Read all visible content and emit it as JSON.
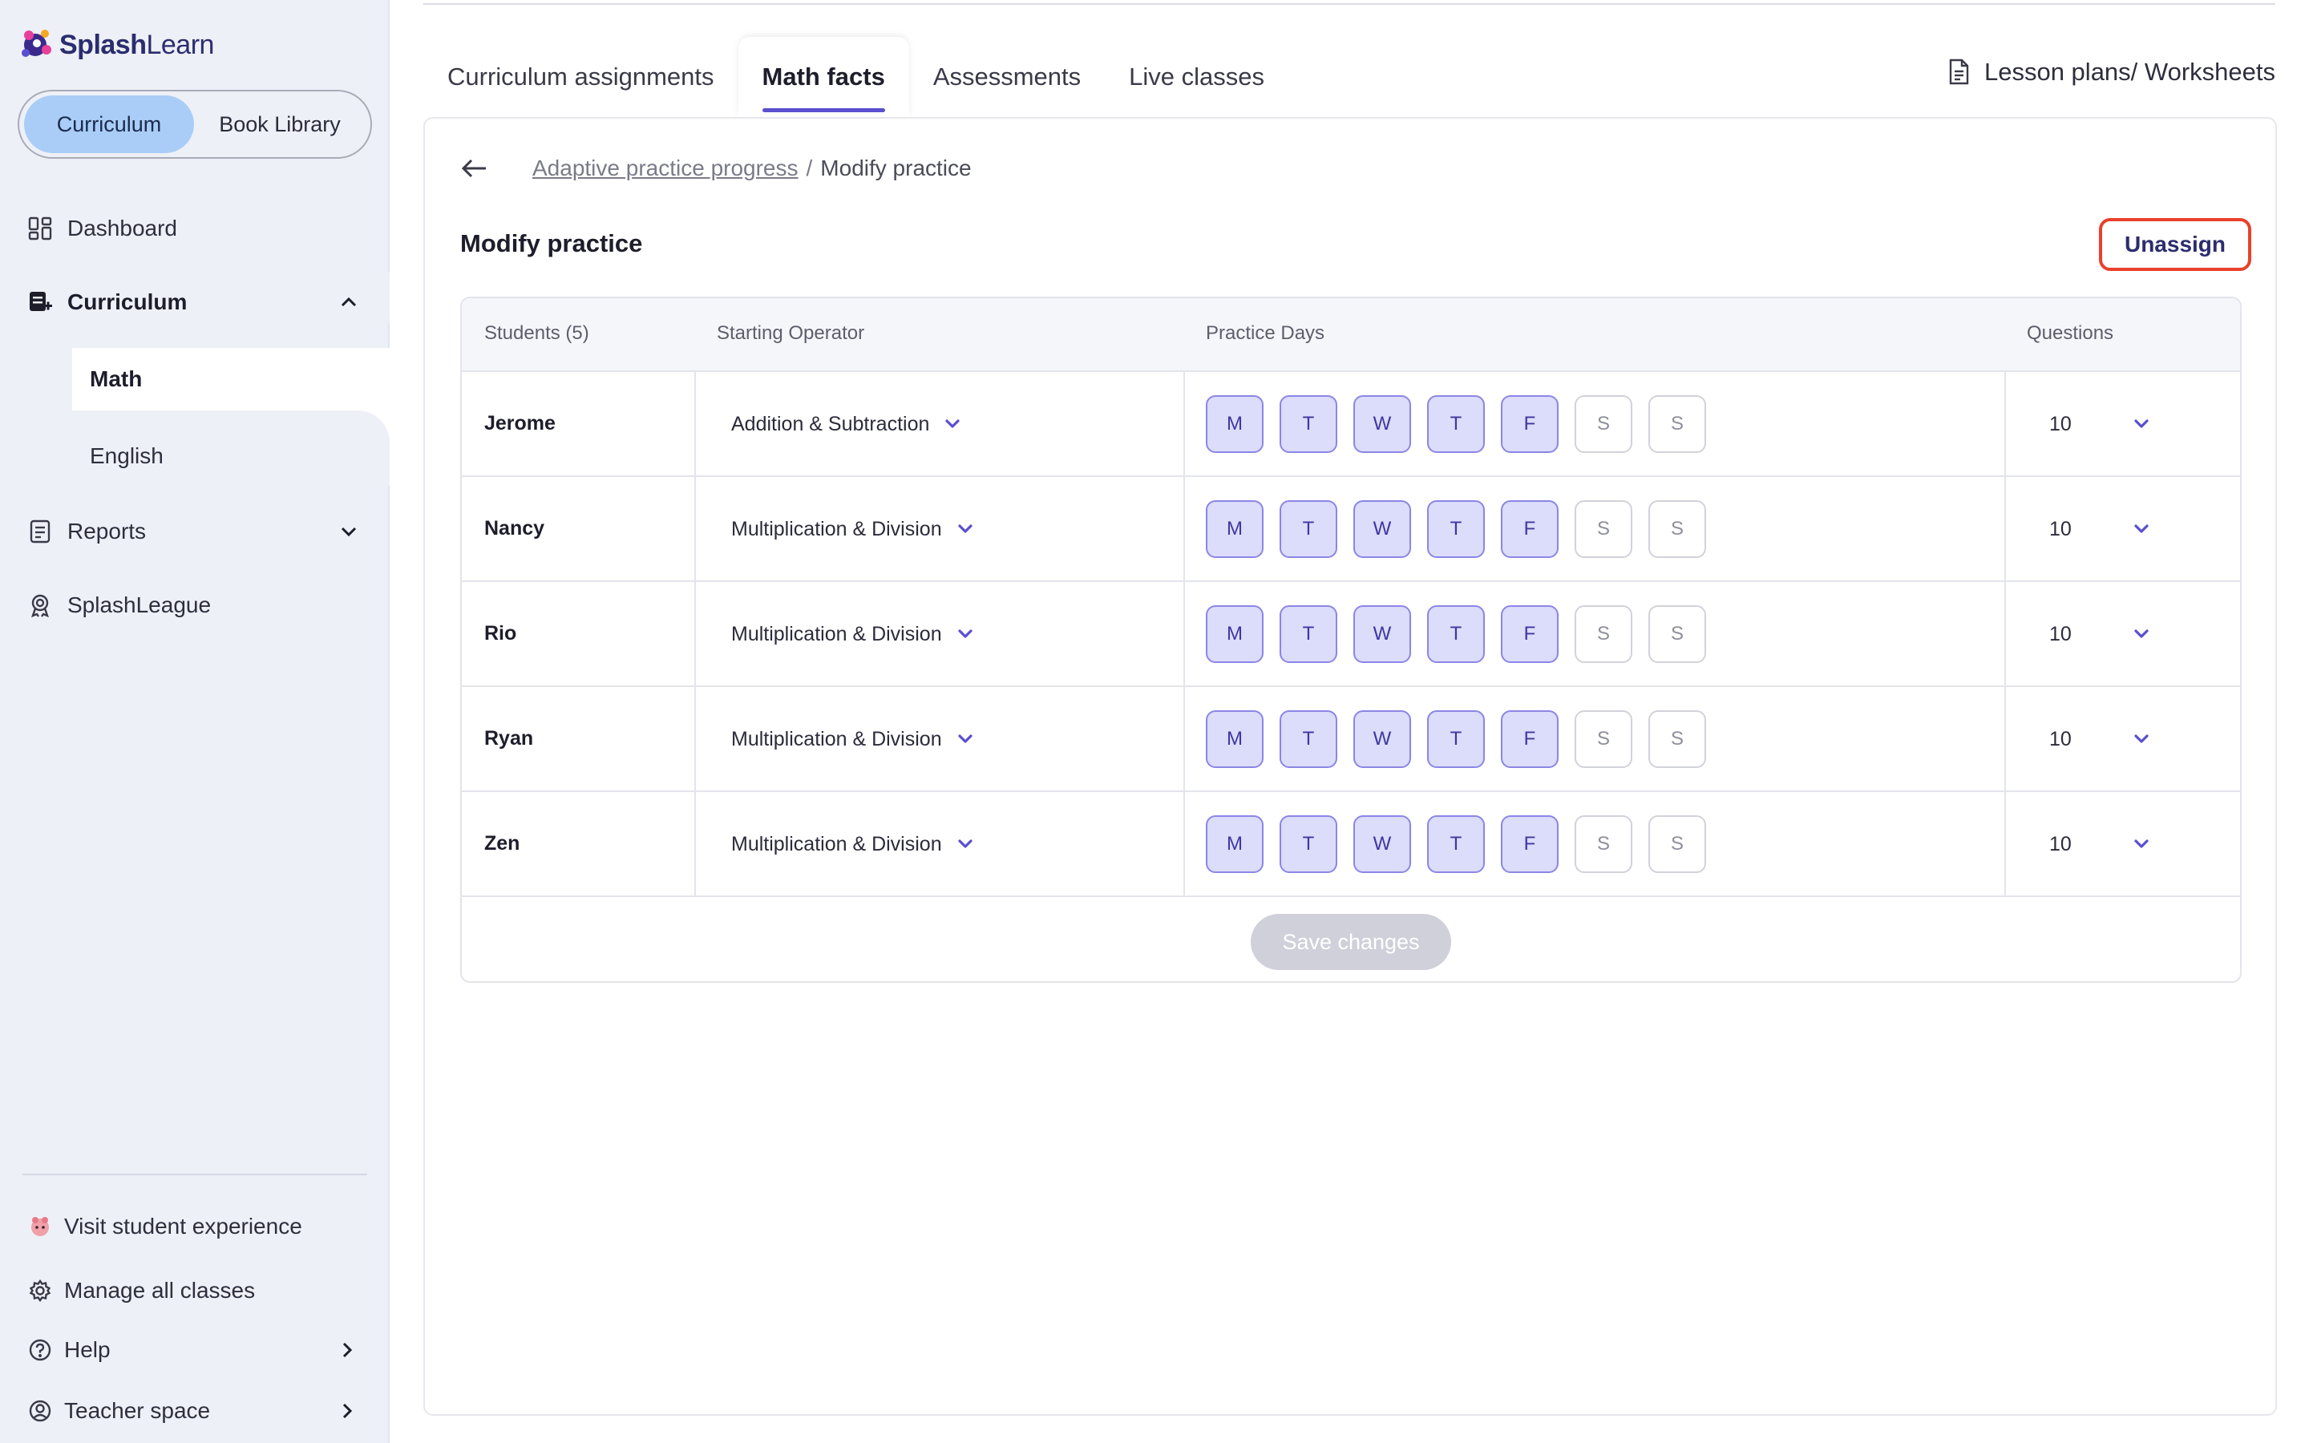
{
  "app": {
    "logo_text_bold": "Splash",
    "logo_text_light": "Learn"
  },
  "sidebar": {
    "toggle": {
      "active": "Curriculum",
      "inactive": "Book Library"
    },
    "nav": {
      "dashboard": "Dashboard",
      "curriculum": "Curriculum",
      "math": "Math",
      "english": "English",
      "reports": "Reports",
      "splashleague": "SplashLeague"
    },
    "footer": {
      "visit_student": "Visit student experience",
      "manage_classes": "Manage all classes",
      "help": "Help",
      "teacher_space": "Teacher space"
    }
  },
  "tabs": [
    {
      "label": "Curriculum assignments"
    },
    {
      "label": "Math facts",
      "active": true
    },
    {
      "label": "Assessments"
    },
    {
      "label": "Live classes"
    }
  ],
  "lesson_link": "Lesson plans/ Worksheets",
  "breadcrumb": {
    "link": "Adaptive practice progress",
    "separator": "/",
    "current": "Modify practice"
  },
  "page_title": "Modify practice",
  "unassign_label": "Unassign",
  "table": {
    "headers": {
      "students": "Students (5)",
      "operator": "Starting Operator",
      "days": "Practice Days",
      "questions": "Questions"
    },
    "day_labels": [
      "M",
      "T",
      "W",
      "T",
      "F",
      "S",
      "S"
    ],
    "rows": [
      {
        "name": "Jerome",
        "operator": "Addition & Subtraction",
        "days_on": [
          true,
          true,
          true,
          true,
          true,
          false,
          false
        ],
        "questions": "10"
      },
      {
        "name": "Nancy",
        "operator": "Multiplication & Division",
        "days_on": [
          true,
          true,
          true,
          true,
          true,
          false,
          false
        ],
        "questions": "10"
      },
      {
        "name": "Rio",
        "operator": "Multiplication & Division",
        "days_on": [
          true,
          true,
          true,
          true,
          true,
          false,
          false
        ],
        "questions": "10"
      },
      {
        "name": "Ryan",
        "operator": "Multiplication & Division",
        "days_on": [
          true,
          true,
          true,
          true,
          true,
          false,
          false
        ],
        "questions": "10"
      },
      {
        "name": "Zen",
        "operator": "Multiplication & Division",
        "days_on": [
          true,
          true,
          true,
          true,
          true,
          false,
          false
        ],
        "questions": "10"
      }
    ]
  },
  "save_label": "Save changes",
  "colors": {
    "accent": "#5a4fcf",
    "day_on_bg": "#dcdcfb",
    "highlight": "#e8412c",
    "toggle_active": "#a9cdf7"
  }
}
